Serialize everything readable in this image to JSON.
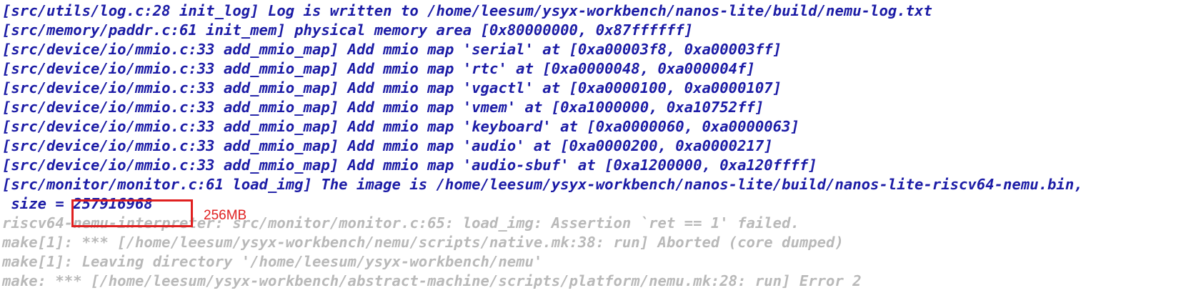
{
  "terminal": {
    "log_lines": [
      "[src/utils/log.c:28 init_log] Log is written to /home/leesum/ysyx-workbench/nanos-lite/build/nemu-log.txt",
      "[src/memory/paddr.c:61 init_mem] physical memory area [0x80000000, 0x87ffffff]",
      "[src/device/io/mmio.c:33 add_mmio_map] Add mmio map 'serial' at [0xa00003f8, 0xa00003ff]",
      "[src/device/io/mmio.c:33 add_mmio_map] Add mmio map 'rtc' at [0xa0000048, 0xa000004f]",
      "[src/device/io/mmio.c:33 add_mmio_map] Add mmio map 'vgactl' at [0xa0000100, 0xa0000107]",
      "[src/device/io/mmio.c:33 add_mmio_map] Add mmio map 'vmem' at [0xa1000000, 0xa10752ff]",
      "[src/device/io/mmio.c:33 add_mmio_map] Add mmio map 'keyboard' at [0xa0000060, 0xa0000063]",
      "[src/device/io/mmio.c:33 add_mmio_map] Add mmio map 'audio' at [0xa0000200, 0xa0000217]",
      "[src/device/io/mmio.c:33 add_mmio_map] Add mmio map 'audio-sbuf' at [0xa1200000, 0xa120ffff]",
      "[src/monitor/monitor.c:61 load_img] The image is /home/leesum/ysyx-workbench/nanos-lite/build/nanos-lite-riscv64-nemu.bin,",
      " size = 257916968"
    ],
    "error_lines": [
      "riscv64-nemu-interpreter: src/monitor/monitor.c:65: load_img: Assertion `ret == 1' failed.",
      "make[1]: *** [/home/leesum/ysyx-workbench/nemu/scripts/native.mk:38: run] Aborted (core dumped)",
      "make[1]: Leaving directory '/home/leesum/ysyx-workbench/nemu'",
      "make: *** [/home/leesum/ysyx-workbench/abstract-machine/scripts/platform/nemu.mk:28: run] Error 2"
    ]
  },
  "annotation": {
    "text": "256MB",
    "color": "#e02020"
  },
  "colors": {
    "log_text": "#1c1ca6",
    "error_text": "#b9b9b9",
    "background": "#ffffff"
  }
}
